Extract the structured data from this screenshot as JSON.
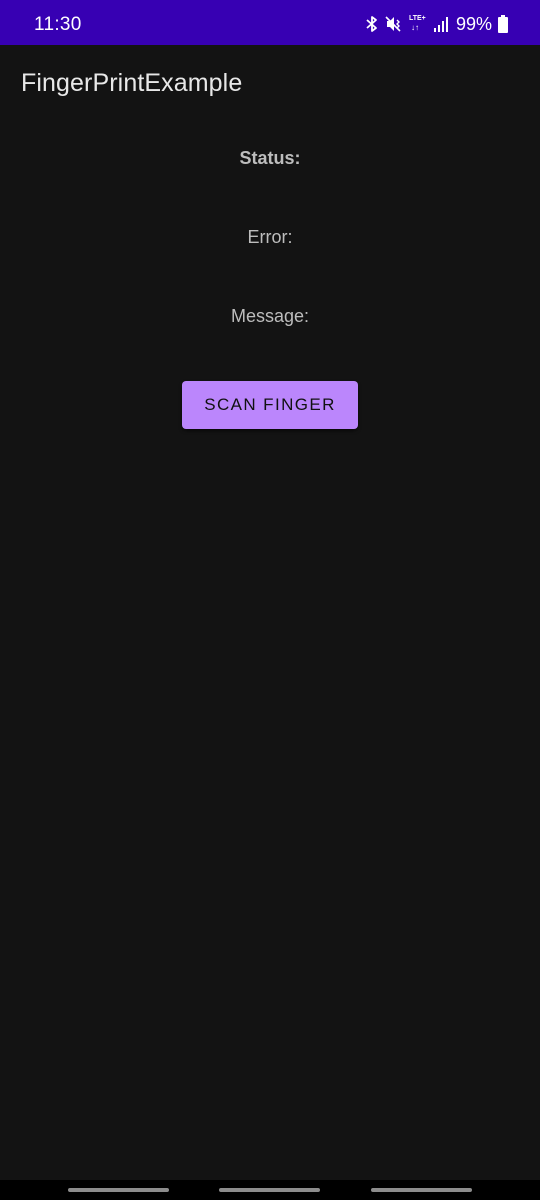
{
  "status_bar": {
    "time": "11:30",
    "network": "LTE+",
    "network_arrows": "↓↑",
    "battery": "99%",
    "icons": [
      "bluetooth-icon",
      "mute-vibrate-icon",
      "lte-icon",
      "signal-icon",
      "battery-icon"
    ]
  },
  "app_bar": {
    "title": "FingerPrintExample"
  },
  "content": {
    "status_label": "Status:",
    "error_label": "Error:",
    "message_label": "Message:",
    "scan_button_label": "SCAN FINGER"
  },
  "colors": {
    "status_bar": "#3700b3",
    "background": "#131313",
    "accent": "#bb86fc",
    "text": "#bdbdbd"
  }
}
